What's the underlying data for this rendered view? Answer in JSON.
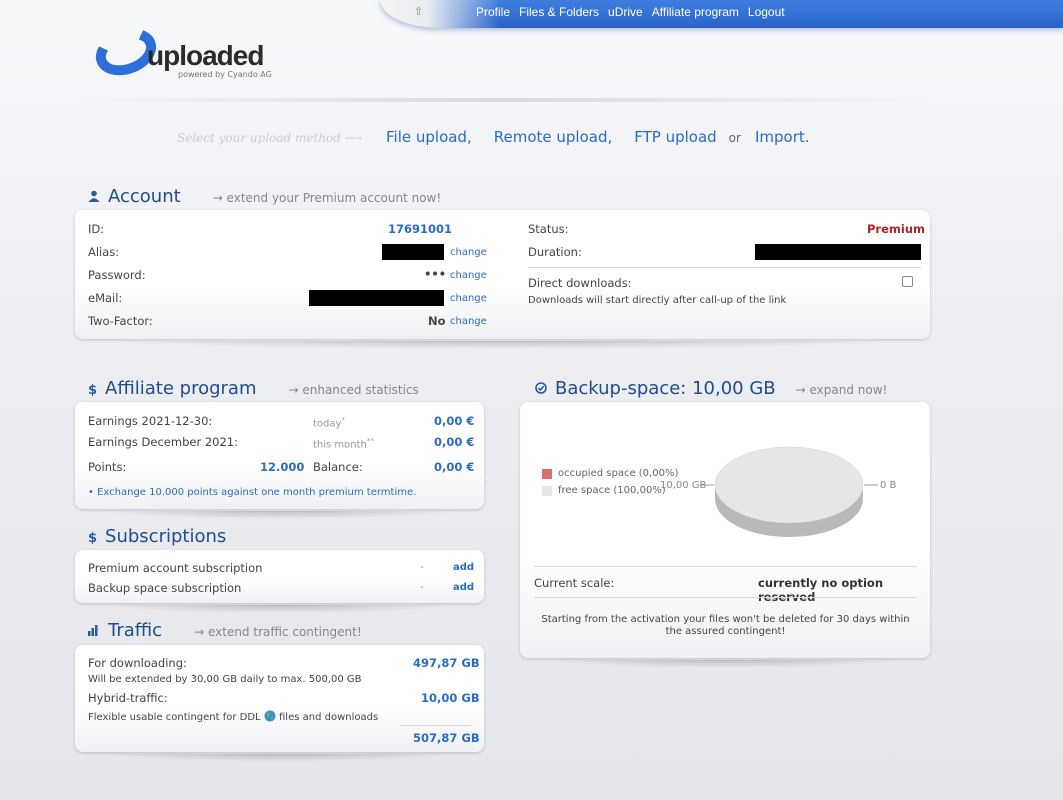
{
  "nav": {
    "items": [
      "Profile",
      "Files & Folders",
      "uDrive",
      "Affiliate program",
      "Logout"
    ]
  },
  "logo": {
    "word": "uploaded",
    "powered": "powered by Cyando AG"
  },
  "upload": {
    "hint": "Select your upload method",
    "file": "File upload,",
    "remote": "Remote upload,",
    "ftp": "FTP upload",
    "or": "or",
    "import": "Import."
  },
  "account": {
    "title": "Account",
    "extend": "→ extend your Premium account now!",
    "id_label": "ID:",
    "id_value": "17691001",
    "alias_label": "Alias:",
    "password_label": "Password:",
    "password_value": "•••",
    "email_label": "eMail:",
    "twofactor_label": "Two-Factor:",
    "twofactor_value": "No",
    "change": "change",
    "status_label": "Status:",
    "status_value": "Premium",
    "duration_label": "Duration:",
    "direct_label": "Direct downloads:",
    "direct_desc": "Downloads will start directly after call-up of the link"
  },
  "affiliate": {
    "title": "Affiliate program",
    "extend": "→ enhanced statistics",
    "earn_day_label": "Earnings 2021-12-30:",
    "today": "today",
    "earn_day_value": "0,00 €",
    "earn_month_label": "Earnings December 2021:",
    "this_month": "this month",
    "earn_month_value": "0,00 €",
    "points_label": "Points:",
    "points_value": "12.000",
    "balance_label": "Balance:",
    "balance_value": "0,00 €",
    "exchange": "• Exchange 10.000 points against one month premium termtime."
  },
  "subscriptions": {
    "title": "Subscriptions",
    "items": [
      {
        "label": "Premium account subscription",
        "dash": "-",
        "action": "add"
      },
      {
        "label": "Backup space subscription",
        "dash": "-",
        "action": "add"
      }
    ]
  },
  "traffic": {
    "title": "Traffic",
    "extend": "→ extend traffic contingent!",
    "download_label": "For downloading:",
    "download_value": "497,87 GB",
    "download_desc": "Will be extended by 30,00 GB daily to max. 500,00 GB",
    "hybrid_label": "Hybrid-traffic:",
    "hybrid_value": "10,00 GB",
    "hybrid_desc": "Flexible usable contingent for DDL",
    "hybrid_desc2": "files and downloads",
    "total": "507,87 GB"
  },
  "backup": {
    "title": "Backup-space: 10,00 GB",
    "extend": "→ expand now!",
    "legend_occupied": "occupied space (0,00%)",
    "legend_free": "free space (100,00%)",
    "label_left": "10,00 GB",
    "label_right": "0 B",
    "scale_label": "Current scale:",
    "scale_value": "currently no option reserved",
    "note": "Starting from the activation your files won't be deleted for 30 days within the assured contingent!"
  },
  "chart_data": {
    "type": "pie",
    "categories": [
      "occupied space (0,00%)",
      "free space (100,00%)"
    ],
    "values": [
      0,
      100
    ]
  },
  "colors": {
    "accent": "#2a6bc6",
    "premium": "#b22222",
    "occupied": "#d9726e",
    "free": "#e6e6e6"
  }
}
